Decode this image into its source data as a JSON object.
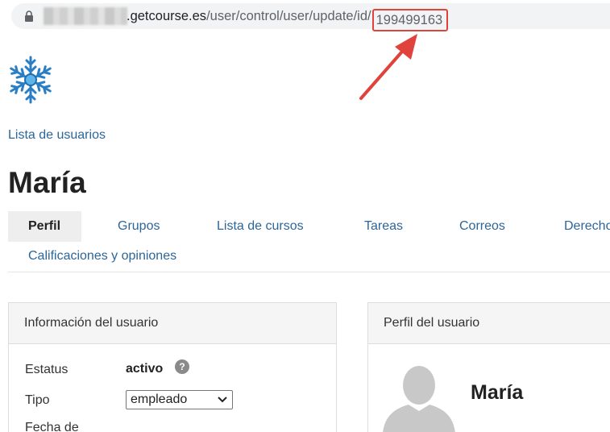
{
  "browser": {
    "url_host": ".getcourse.es",
    "url_path": "/user/control/user/update/id/",
    "url_id": "199499163"
  },
  "breadcrumb": {
    "label": "Lista de usuarios"
  },
  "page": {
    "title": "María"
  },
  "tabs": [
    {
      "label": "Perfil",
      "active": true
    },
    {
      "label": "Grupos"
    },
    {
      "label": "Lista de cursos"
    },
    {
      "label": "Tareas"
    },
    {
      "label": "Correos"
    },
    {
      "label": "Derechos"
    },
    {
      "label": "Calificaciones y opiniones"
    }
  ],
  "user_info": {
    "header": "Información del usuario",
    "status_label": "Estatus",
    "status_value": "activo",
    "type_label": "Tipo",
    "type_value": "empleado",
    "date_label": "Fecha de"
  },
  "profile": {
    "header": "Perfil del usuario",
    "name": "María"
  },
  "icons": {
    "lock": "lock-icon",
    "help": "help-icon",
    "logo": "snowflake-icon",
    "avatar": "avatar-placeholder-icon",
    "chevron": "chevron-down-icon"
  },
  "colors": {
    "link": "#2c6699",
    "annotation": "#e0433b",
    "tab_active_bg": "#eeeeee",
    "panel_header_bg": "#f5f5f5"
  }
}
